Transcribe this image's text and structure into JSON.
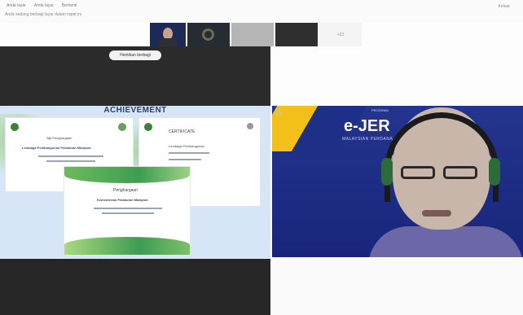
{
  "toolbar": {
    "menu": [
      "Anda layar",
      "Anda layar",
      "Berhenti"
    ],
    "subtitle": "Anda sedang berbagi layar dalam rapat ini",
    "right_label": "Keluar"
  },
  "thumbnails": [
    {
      "label": ""
    },
    {
      "label": ""
    },
    {
      "label": ""
    },
    {
      "label": ""
    },
    {
      "label": "+22"
    }
  ],
  "banner": {
    "label": "Hentikan berbagi"
  },
  "shared_screen": {
    "heading": "ACHIEVEMENT",
    "cert1": {
      "title": "Sijil Penghargaan",
      "name": "Lembaga Pembangunan Pelaburan Malaysia"
    },
    "cert2": {
      "title": "CERTIFICATE",
      "name": "Lembaga Pembangunan"
    },
    "cert3": {
      "title": "Penghargaan",
      "name": "Kementerian Pelaburan Malaysia"
    }
  },
  "video": {
    "brand": "e-JER",
    "caption": "MALAYSIAN PERDANA",
    "small": "PROGRAM"
  },
  "colors": {
    "slide_bg": "#1d2f86",
    "accent_yellow": "#f2c019",
    "cert_green": "#3f9c53"
  }
}
